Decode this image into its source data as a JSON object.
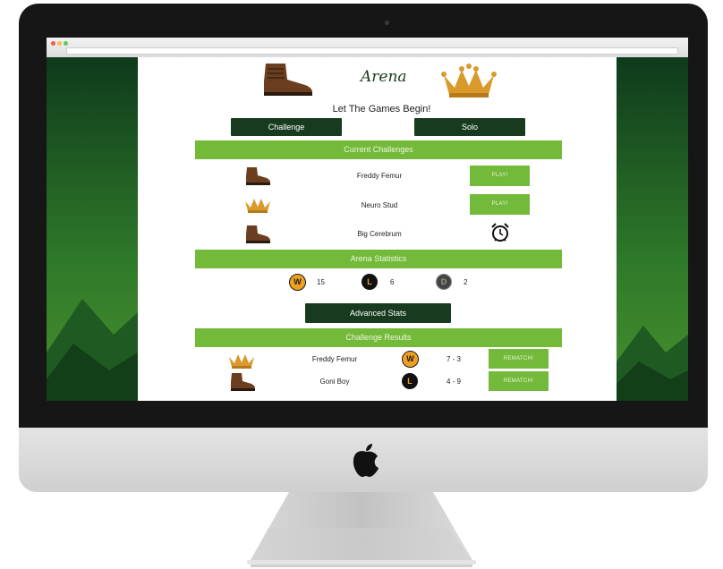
{
  "app": {
    "title": "Arena",
    "subtitle": "Let The Games Begin!",
    "challenge_button": "Challenge",
    "solo_button": "Solo",
    "advanced_stats_button": "Advanced Stats"
  },
  "current_challenges": {
    "header": "Current Challenges",
    "rows": [
      {
        "icon": "boot-icon",
        "name": "Freddy Femur",
        "action": "PLAY!"
      },
      {
        "icon": "crown-icon",
        "name": "Neuro Stud",
        "action": "PLAY!"
      },
      {
        "icon": "boot-icon",
        "name": "Big Cerebrum",
        "action": "alarm-clock-icon"
      }
    ]
  },
  "arena_statistics": {
    "header": "Arena Statistics",
    "wins": {
      "badge": "W",
      "count": "15"
    },
    "losses": {
      "badge": "L",
      "count": "6"
    },
    "draws": {
      "badge": "D",
      "count": "2"
    }
  },
  "challenge_results": {
    "header": "Challenge Results",
    "rows": [
      {
        "icon": "crown-icon",
        "name": "Freddy Femur",
        "result": "W",
        "score": "7 - 3",
        "action": "REMATCH!"
      },
      {
        "icon": "boot-icon",
        "name": "Goni Boy",
        "result": "L",
        "score": "4 - 9",
        "action": "REMATCH!"
      }
    ]
  },
  "colors": {
    "accent_green": "#74ba3a",
    "dark_green": "#183b1f",
    "win_orange": "#f0a020",
    "boot_brown": "#6b3e1f",
    "crown_gold": "#d99a2b"
  }
}
